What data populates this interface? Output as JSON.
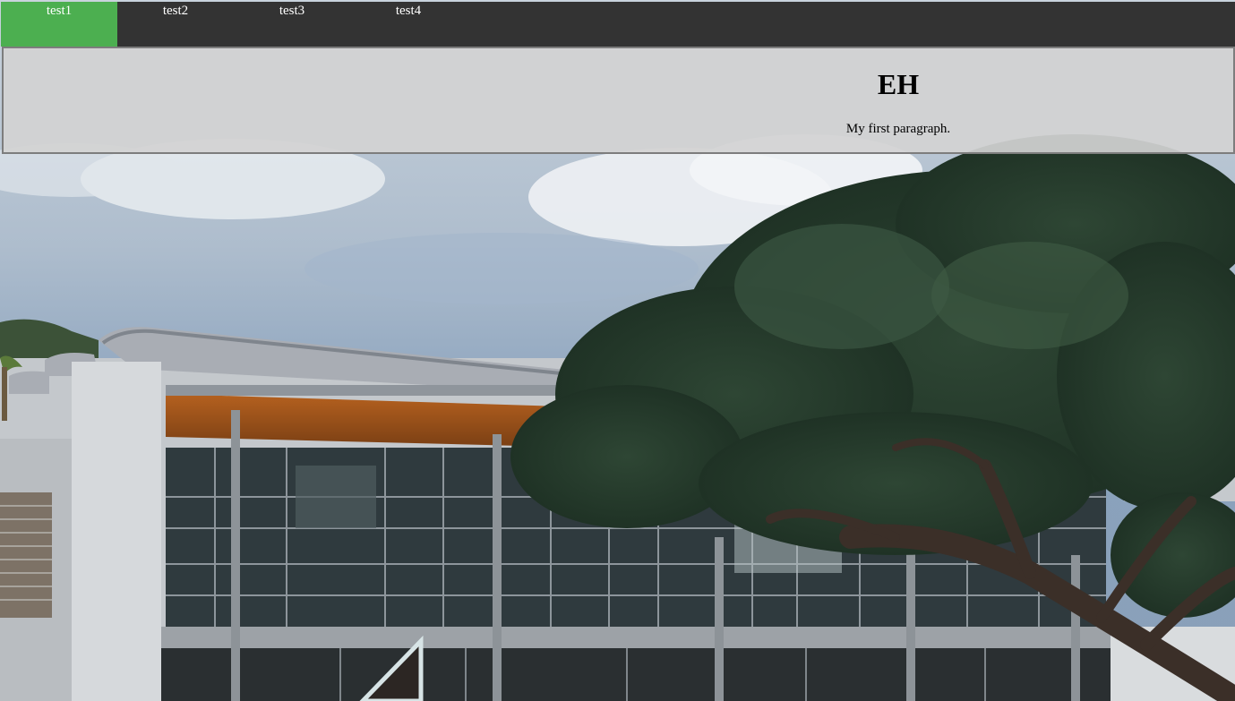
{
  "nav": {
    "items": [
      {
        "label": "test1",
        "active": true
      },
      {
        "label": "test2",
        "active": false
      },
      {
        "label": "test3",
        "active": false
      },
      {
        "label": "test4",
        "active": false
      }
    ],
    "active_color": "#4caf50",
    "bar_color": "#333333"
  },
  "header": {
    "title": "EH",
    "paragraph": "My first paragraph."
  },
  "background": {
    "subject": "modern glass building with curved roof under a large monkeypod tree and cloudy sky"
  }
}
